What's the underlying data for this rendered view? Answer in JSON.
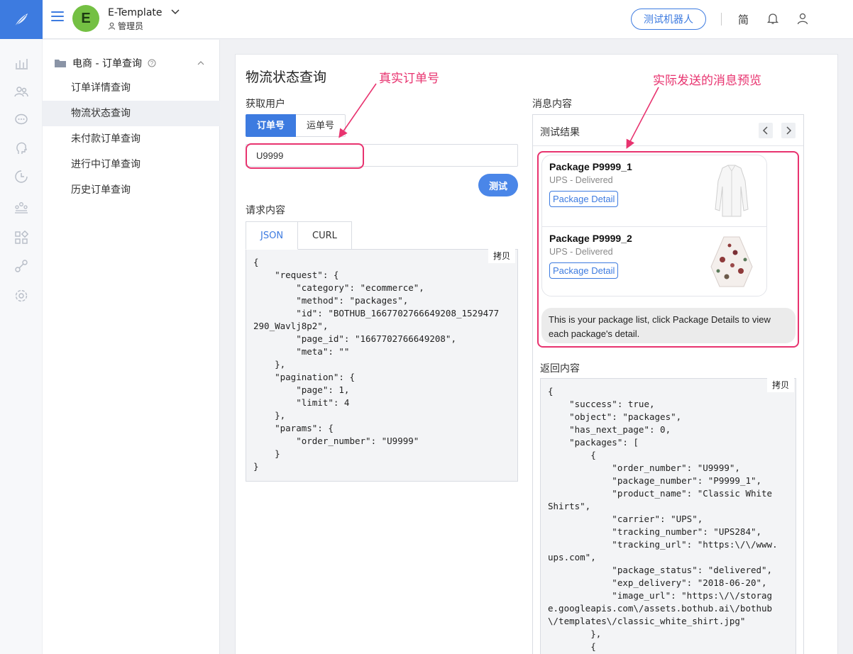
{
  "header": {
    "avatar_letter": "E",
    "template_name": "E-Template",
    "role": "管理员",
    "robot_button": "测试机器人",
    "lang": "简",
    "brand_color": "#3d7be0"
  },
  "sidebar": {
    "group_title": "电商 - 订单查询",
    "items": [
      {
        "label": "订单详情查询"
      },
      {
        "label": "物流状态查询"
      },
      {
        "label": "未付款订单查询"
      },
      {
        "label": "进行中订单查询"
      },
      {
        "label": "历史订单查询"
      }
    ],
    "active_index": 1
  },
  "rail_icons": [
    "chart-icon",
    "users-icon",
    "chat-icon",
    "brain-icon",
    "clock-icon",
    "team-icon",
    "apps-icon",
    "link-icon",
    "gear-icon"
  ],
  "main": {
    "title": "物流状态查询",
    "get_user_label": "获取用户",
    "segment": {
      "selected": "订单号",
      "other": "运单号"
    },
    "order_value": "U9999",
    "test_button": "测试",
    "request_label": "请求内容",
    "tabs": {
      "json": "JSON",
      "curl": "CURL"
    },
    "copy_label": "拷贝",
    "request_code": "{\n    \"request\": {\n        \"category\": \"ecommerce\",\n        \"method\": \"packages\",\n        \"id\": \"BOTHUB_1667702766649208_1529477\n290_Wavlj8p2\",\n        \"page_id\": \"1667702766649208\",\n        \"meta\": \"\"\n    },\n    \"pagination\": {\n        \"page\": 1,\n        \"limit\": 4\n    },\n    \"params\": {\n        \"order_number\": \"U9999\"\n    }\n}"
  },
  "annotations": {
    "order": "真实订单号",
    "preview": "实际发送的消息预览",
    "color": "#e8336f"
  },
  "preview": {
    "label": "消息内容",
    "header": "测试结果",
    "packages": [
      {
        "name": "Package P9999_1",
        "status": "UPS - Delivered",
        "button": "Package Detail"
      },
      {
        "name": "Package P9999_2",
        "status": "UPS - Delivered",
        "button": "Package Detail"
      }
    ],
    "bubble_text": "This is your package list, click Package Details to view each package's detail.",
    "response_label": "返回内容",
    "copy_label": "拷贝",
    "response_code": "{\n    \"success\": true,\n    \"object\": \"packages\",\n    \"has_next_page\": 0,\n    \"packages\": [\n        {\n            \"order_number\": \"U9999\",\n            \"package_number\": \"P9999_1\",\n            \"product_name\": \"Classic White\nShirts\",\n            \"carrier\": \"UPS\",\n            \"tracking_number\": \"UPS284\",\n            \"tracking_url\": \"https:\\/\\/www.\nups.com\",\n            \"package_status\": \"delivered\",\n            \"exp_delivery\": \"2018-06-20\",\n            \"image_url\": \"https:\\/\\/storag\ne.googleapis.com\\/assets.bothub.ai\\/bothub\n\\/templates\\/classic_white_shirt.jpg\"\n        },\n        {"
  }
}
